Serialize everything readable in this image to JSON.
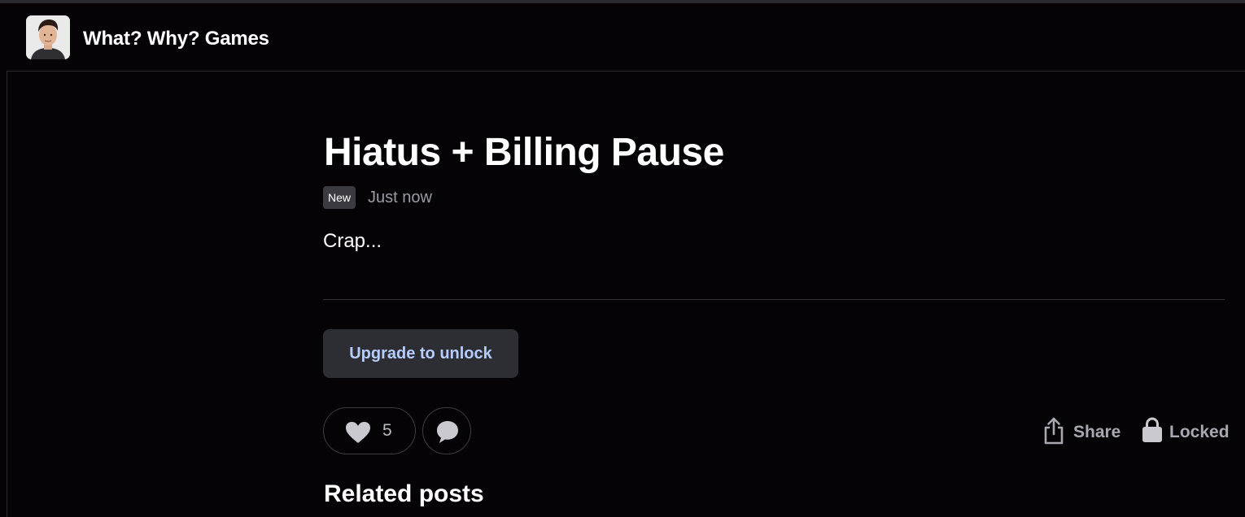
{
  "header": {
    "creator_name": "What? Why? Games",
    "avatar_icon": "creator-avatar"
  },
  "post": {
    "title": "Hiatus + Billing Pause",
    "badge": "New",
    "timestamp": "Just now",
    "teaser": "Crap..."
  },
  "actions": {
    "upgrade_label": "Upgrade to unlock",
    "like_count": "5",
    "like_icon": "heart-icon",
    "comment_icon": "comment-icon",
    "share_label": "Share",
    "share_icon": "share-icon",
    "locked_label": "Locked",
    "locked_icon": "lock-icon"
  },
  "related": {
    "heading": "Related posts"
  },
  "colors": {
    "background": "#050306",
    "upgrade_text": "#b6cdff",
    "upgrade_bg": "#2d2e34",
    "muted": "#9b9ba3"
  }
}
